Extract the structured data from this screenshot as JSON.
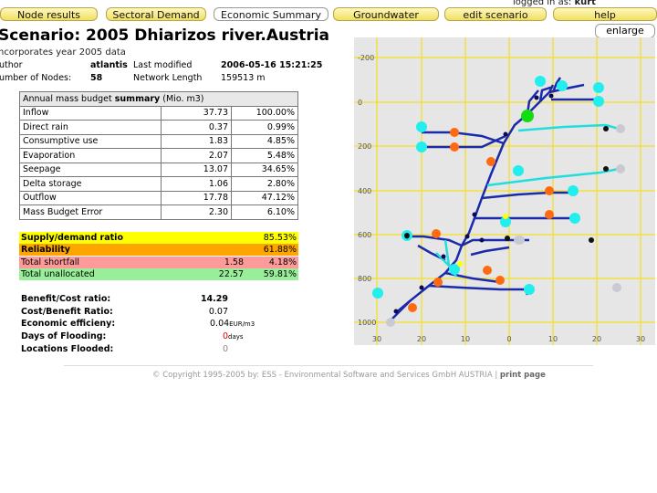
{
  "tabs": [
    {
      "label": "Node results",
      "active": false
    },
    {
      "label": "Sectoral Demand",
      "active": false
    },
    {
      "label": "Economic Summary",
      "active": true
    },
    {
      "label": "Groundwater",
      "active": false
    },
    {
      "label": "edit scenario",
      "active": false
    },
    {
      "label": "help",
      "active": false
    }
  ],
  "session": {
    "logged_prefix": "logged in as:",
    "user": "kurt"
  },
  "enlarge_label": "enlarge",
  "page_title": "Scenario: 2005 Dhiarizos river.Austria",
  "subtitle": "ncorporates year 2005 data",
  "meta": {
    "author_label": "uthor",
    "author": "atlantis",
    "modified_label": "Last modified",
    "modified": "2006-05-16 15:21:25",
    "nodes_label": "umber of Nodes:",
    "nodes": "58",
    "length_label": "Network Length",
    "length": "159513 m"
  },
  "mass_budget": {
    "title_prefix": "Annual mass budget ",
    "title_bold": "summary",
    "title_suffix": " (Mio. m3)",
    "rows": [
      {
        "label": "Inflow",
        "value": "37.73",
        "pct": "100.00%"
      },
      {
        "label": "Direct rain",
        "value": "0.37",
        "pct": "0.99%"
      },
      {
        "label": "Consumptive use",
        "value": "1.83",
        "pct": "4.85%"
      },
      {
        "label": "Evaporation",
        "value": "2.07",
        "pct": "5.48%"
      },
      {
        "label": "Seepage",
        "value": "13.07",
        "pct": "34.65%"
      },
      {
        "label": "Delta storage",
        "value": "1.06",
        "pct": "2.80%"
      },
      {
        "label": "Outflow",
        "value": "17.78",
        "pct": "47.12%"
      },
      {
        "label": "Mass Budget Error",
        "value": "2.30",
        "pct": "6.10%"
      }
    ]
  },
  "ratios": [
    {
      "label": "Supply/demand ratio",
      "value": "",
      "pct": "85.53%",
      "color": "#ffff00"
    },
    {
      "label": "Reliability",
      "value": "",
      "pct": "61.88%",
      "color": "#ffa500"
    },
    {
      "label": "Total shortfall",
      "value": "1.58",
      "pct": "4.18%",
      "color": "#ff9a9a"
    },
    {
      "label": "Total unallocated",
      "value": "22.57",
      "pct": "59.81%",
      "color": "#99ee99"
    }
  ],
  "economics": [
    {
      "label": "Benefit/Cost ratio:",
      "value": "14.29",
      "unit": ""
    },
    {
      "label": "Cost/Benefit Ratio:",
      "value": "0.07",
      "unit": ""
    },
    {
      "label": "Economic efficieny:",
      "value": "0.04",
      "unit": "EUR/m3"
    },
    {
      "label": "Days of Flooding:",
      "value": "0",
      "unit": "days"
    },
    {
      "label": "Locations Flooded:",
      "value": "0",
      "unit": ""
    }
  ],
  "footer": {
    "copyright": "© Copyright 1995-2005 by: ESS - Environmental Software and Services GmbH AUSTRIA",
    "sep": " | ",
    "print": "print page"
  },
  "map": {
    "y_ticks": [
      "-200",
      "0",
      "200",
      "400",
      "600",
      "800",
      "1000"
    ],
    "x_ticks": [
      "30",
      "20",
      "10",
      "0",
      "10",
      "20",
      "30"
    ],
    "colors": {
      "grid": "#f0e040",
      "river": "#1a2aaa",
      "diversion": "#22dddd",
      "demand": "#ff6a10",
      "supply": "#22eeee"
    }
  }
}
